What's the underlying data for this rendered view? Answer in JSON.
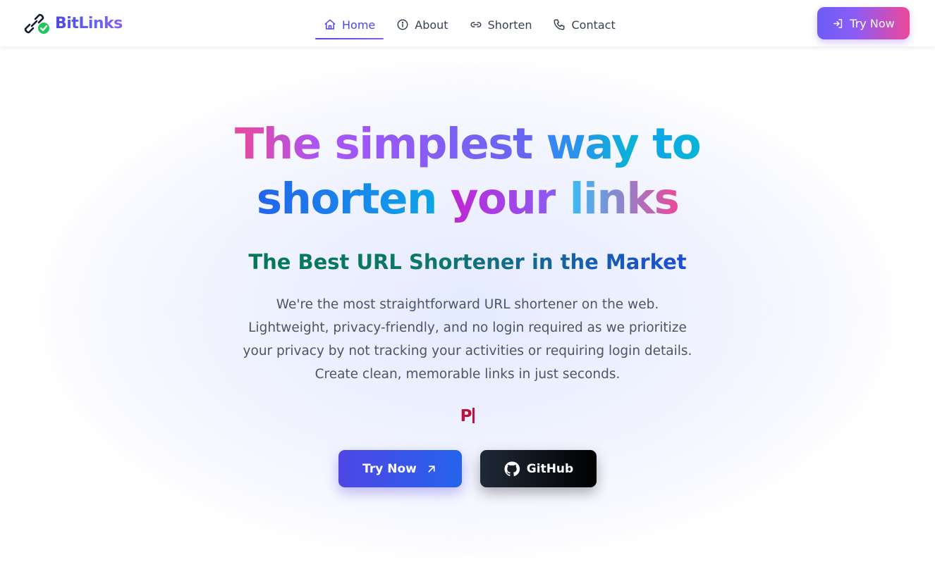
{
  "brand": {
    "name": "BitLinks",
    "icon": "link-check-icon"
  },
  "nav": {
    "items": [
      {
        "label": "Home",
        "icon": "home-icon",
        "active": true
      },
      {
        "label": "About",
        "icon": "info-icon",
        "active": false
      },
      {
        "label": "Shorten",
        "icon": "link-icon",
        "active": false
      },
      {
        "label": "Contact",
        "icon": "phone-icon",
        "active": false
      }
    ],
    "cta_label": "Try Now",
    "cta_icon": "sign-in-icon"
  },
  "hero": {
    "headline_words": [
      "The",
      "simplest",
      "way",
      "to",
      "shorten",
      "your",
      "links"
    ],
    "subheadline": "The Best URL Shortener in the Market",
    "description_lines": [
      "We're the most straightforward URL shortener on the web.",
      "Lightweight, privacy-friendly, and no login required as we prioritize",
      "your privacy by not tracking your activities or requiring login details.",
      "Create clean, memorable links in just seconds."
    ],
    "typing_text": "P",
    "primary_button": {
      "label": "Try Now",
      "icon": "arrow-up-right-icon"
    },
    "secondary_button": {
      "label": "GitHub",
      "icon": "github-icon"
    }
  },
  "colors": {
    "accent": "#4f46e5",
    "cta_gradient_start": "#6d5cf6",
    "cta_gradient_end": "#ec4899",
    "typing_text": "#be123c",
    "subheadline_start": "#047857",
    "subheadline_end": "#1d4ed8"
  }
}
